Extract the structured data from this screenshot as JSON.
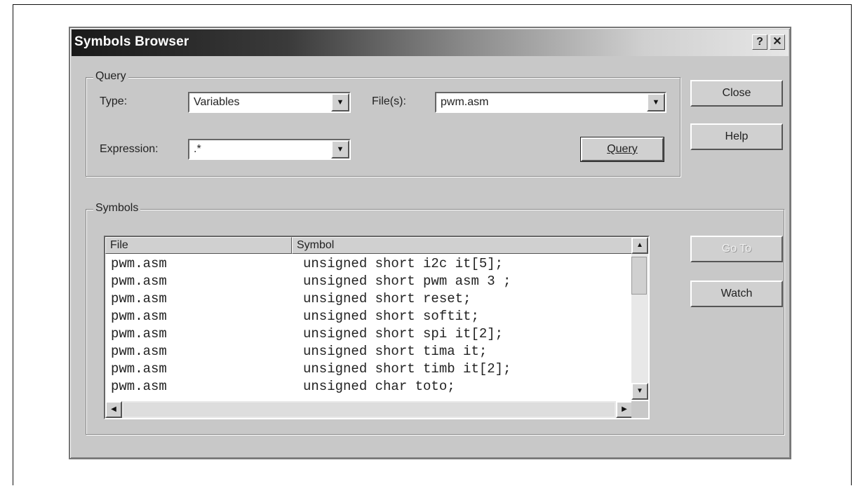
{
  "window": {
    "title": "Symbols Browser",
    "help_label": "?",
    "close_label": "✕"
  },
  "query": {
    "group_label": "Query",
    "type_label": "Type:",
    "type_value": "Variables",
    "files_label": "File(s):",
    "files_value": "pwm.asm",
    "expression_label": "Expression:",
    "expression_value": ".*",
    "query_button": "Query"
  },
  "buttons": {
    "close": "Close",
    "help": "Help",
    "goto": "Go To",
    "watch": "Watch"
  },
  "symbols": {
    "group_label": "Symbols",
    "columns": [
      "File",
      "Symbol"
    ],
    "rows": [
      {
        "file": "pwm.asm",
        "symbol": "unsigned short i2c it[5];"
      },
      {
        "file": "pwm.asm",
        "symbol": "unsigned short pwm asm 3 ;"
      },
      {
        "file": "pwm.asm",
        "symbol": "unsigned short reset;"
      },
      {
        "file": "pwm.asm",
        "symbol": "unsigned short softit;"
      },
      {
        "file": "pwm.asm",
        "symbol": "unsigned short spi it[2];"
      },
      {
        "file": "pwm.asm",
        "symbol": "unsigned short tima it;"
      },
      {
        "file": "pwm.asm",
        "symbol": "unsigned short timb it[2];"
      },
      {
        "file": "pwm.asm",
        "symbol": "unsigned char toto;"
      }
    ]
  }
}
